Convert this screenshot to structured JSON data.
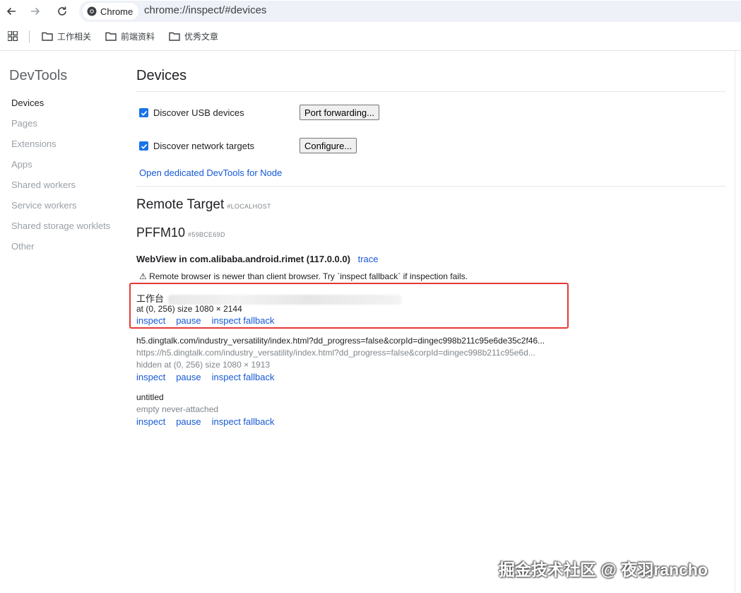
{
  "browser": {
    "chip_label": "Chrome",
    "url": "chrome://inspect/#devices"
  },
  "bookmarks": [
    {
      "label": "工作相关"
    },
    {
      "label": "前端资料"
    },
    {
      "label": "优秀文章"
    }
  ],
  "sidebar": {
    "title": "DevTools",
    "items": [
      {
        "label": "Devices",
        "active": true
      },
      {
        "label": "Pages"
      },
      {
        "label": "Extensions"
      },
      {
        "label": "Apps"
      },
      {
        "label": "Shared workers"
      },
      {
        "label": "Service workers"
      },
      {
        "label": "Shared storage worklets"
      },
      {
        "label": "Other"
      }
    ]
  },
  "devices": {
    "title": "Devices",
    "discover_usb": {
      "label": "Discover USB devices",
      "checked": true
    },
    "port_forwarding_label": "Port forwarding...",
    "discover_network": {
      "label": "Discover network targets",
      "checked": true
    },
    "configure_label": "Configure...",
    "node_link": "Open dedicated DevTools for Node"
  },
  "remote": {
    "title": "Remote Target",
    "note": "#LOCALHOST",
    "device_name": "PFFM10",
    "device_id": "#59BCE69D",
    "browser_name": "WebView in com.alibaba.android.rimet (117.0.0.0)",
    "trace_label": "trace",
    "warning": "⚠ Remote browser is newer than client browser. Try `inspect fallback` if inspection fails.",
    "targets": [
      {
        "title": "工作台",
        "info": "at (0, 256)  size 1080 × 2144",
        "actions": [
          "inspect",
          "pause",
          "inspect fallback"
        ]
      },
      {
        "title": "h5.dingtalk.com/industry_versatility/index.html?dd_progress=false&corpId=dingec998b211c95e6de35c2f46...",
        "url": "https://h5.dingtalk.com/industry_versatility/index.html?dd_progress=false&corpId=dingec998b211c95e6d...",
        "info": "hidden  at (0, 256)  size 1080 × 1913",
        "actions": [
          "inspect",
          "pause",
          "inspect fallback"
        ]
      },
      {
        "title": "untitled",
        "info": "empty never-attached",
        "actions": [
          "inspect",
          "pause",
          "inspect fallback"
        ]
      }
    ]
  },
  "watermark": "掘金技术社区 @ 夜羽rancho",
  "colors": {
    "accent": "#1a73e8",
    "link": "#1558d6",
    "highlight": "#e53935"
  }
}
